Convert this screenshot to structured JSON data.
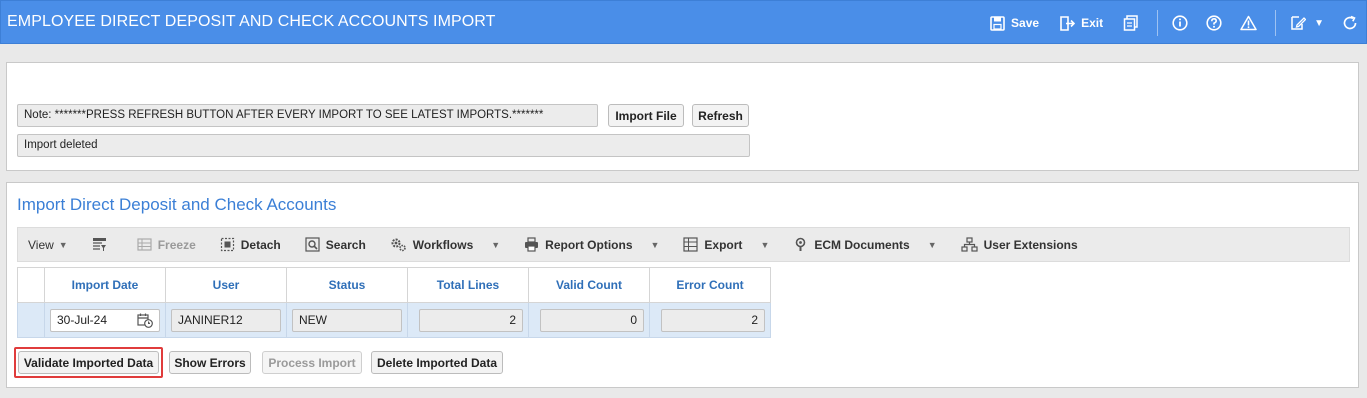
{
  "header": {
    "title": "EMPLOYEE DIRECT DEPOSIT AND CHECK ACCOUNTS IMPORT",
    "save_label": "Save",
    "exit_label": "Exit"
  },
  "top_panel": {
    "note": "Note: *******PRESS REFRESH BUTTON AFTER EVERY IMPORT TO SEE LATEST IMPORTS.*******",
    "import_file_label": "Import File",
    "refresh_label": "Refresh",
    "status": "Import deleted"
  },
  "import_section": {
    "title": "Import Direct Deposit and Check Accounts",
    "toolbar": {
      "view": "View",
      "freeze": "Freeze",
      "detach": "Detach",
      "search": "Search",
      "workflows": "Workflows",
      "report_options": "Report Options",
      "export": "Export",
      "ecm_documents": "ECM Documents",
      "user_extensions": "User Extensions"
    },
    "columns": [
      "Import Date",
      "User",
      "Status",
      "Total Lines",
      "Valid Count",
      "Error Count"
    ],
    "rows": [
      {
        "import_date": "30-Jul-24",
        "user": "JANINER12",
        "status": "NEW",
        "total_lines": "2",
        "valid_count": "0",
        "error_count": "2"
      }
    ],
    "buttons": {
      "validate": "Validate Imported Data",
      "show_errors": "Show Errors",
      "process_import": "Process Import",
      "delete": "Delete Imported Data"
    }
  },
  "colors": {
    "header_bg": "#4a8ee8",
    "section_title": "#3b7fd6",
    "column_header_text": "#2f6fb8",
    "selected_row_bg": "#dce9f7",
    "highlight_border": "#e03c3c"
  }
}
